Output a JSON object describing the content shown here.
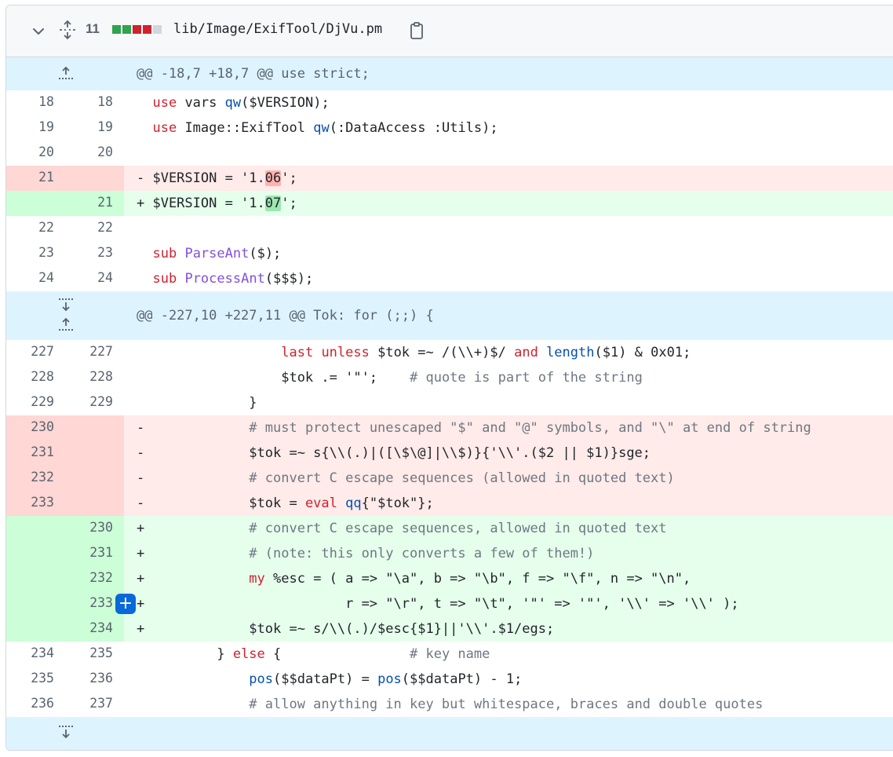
{
  "file": {
    "change_count": "11",
    "path": "lib/Image/ExifTool/DjVu.pm",
    "diffstat_colors": [
      "#2da44e",
      "#2da44e",
      "#cf222e",
      "#cf222e",
      "#d0d7de"
    ]
  },
  "hunks": [
    {
      "header": "@@ -18,7 +18,7 @@ use strict;"
    },
    {
      "header": "@@ -227,10 +227,11 @@ Tok: for (;;) {"
    }
  ],
  "rows": [
    {
      "type": "ctx",
      "old": "18",
      "new": "18",
      "text": "  use vars qw($VERSION);"
    },
    {
      "type": "ctx",
      "old": "19",
      "new": "19",
      "text": "  use Image::ExifTool qw(:DataAccess :Utils);"
    },
    {
      "type": "ctx",
      "old": "20",
      "new": "20",
      "text": ""
    },
    {
      "type": "del",
      "old": "21",
      "new": "",
      "text": "- $VERSION = '1.06';"
    },
    {
      "type": "add",
      "old": "",
      "new": "21",
      "text": "+ $VERSION = '1.07';"
    },
    {
      "type": "ctx",
      "old": "22",
      "new": "22",
      "text": ""
    },
    {
      "type": "ctx",
      "old": "23",
      "new": "23",
      "text": "  sub ParseAnt($);"
    },
    {
      "type": "ctx",
      "old": "24",
      "new": "24",
      "text": "  sub ProcessAnt($$$);"
    },
    {
      "type": "ctx",
      "old": "227",
      "new": "227",
      "text": "                  last unless $tok =~ /(\\\\+)$/ and length($1) & 0x01;"
    },
    {
      "type": "ctx",
      "old": "228",
      "new": "228",
      "text": "                  $tok .= '\"';    # quote is part of the string"
    },
    {
      "type": "ctx",
      "old": "229",
      "new": "229",
      "text": "              }"
    },
    {
      "type": "del",
      "old": "230",
      "new": "",
      "text": "-             # must protect unescaped \"$\" and \"@\" symbols, and \"\\\" at end of string"
    },
    {
      "type": "del",
      "old": "231",
      "new": "",
      "text": "-             $tok =~ s{\\\\(.)|([\\$\\@]|\\\\$)}{'\\\\'.($2 || $1)}sge;"
    },
    {
      "type": "del",
      "old": "232",
      "new": "",
      "text": "-             # convert C escape sequences (allowed in quoted text)"
    },
    {
      "type": "del",
      "old": "233",
      "new": "",
      "text": "-             $tok = eval qq{\"$tok\"};"
    },
    {
      "type": "add",
      "old": "",
      "new": "230",
      "text": "+             # convert C escape sequences, allowed in quoted text"
    },
    {
      "type": "add",
      "old": "",
      "new": "231",
      "text": "+             # (note: this only converts a few of them!)"
    },
    {
      "type": "add",
      "old": "",
      "new": "232",
      "text": "+             my %esc = ( a => \"\\a\", b => \"\\b\", f => \"\\f\", n => \"\\n\","
    },
    {
      "type": "add",
      "old": "",
      "new": "233",
      "text": "+                         r => \"\\r\", t => \"\\t\", '\"' => '\"', '\\\\' => '\\\\' );"
    },
    {
      "type": "add",
      "old": "",
      "new": "234",
      "text": "+             $tok =~ s/\\\\(.)/$esc{$1}||'\\\\'.$1/egs;"
    },
    {
      "type": "ctx",
      "old": "234",
      "new": "235",
      "text": "          } else {                # key name"
    },
    {
      "type": "ctx",
      "old": "235",
      "new": "236",
      "text": "              pos($$dataPt) = pos($$dataPt) - 1;"
    },
    {
      "type": "ctx",
      "old": "236",
      "new": "237",
      "text": "              # allow anything in key but whitespace, braces and double quotes"
    }
  ],
  "icons": {
    "collapse": "chevron-down-icon",
    "expand_all": "unfold-icon",
    "copy": "copy-icon",
    "expand_up": "expand-up-icon",
    "expand_down": "expand-down-icon",
    "add_comment": "plus-icon"
  },
  "add_comment_symbol": "+"
}
